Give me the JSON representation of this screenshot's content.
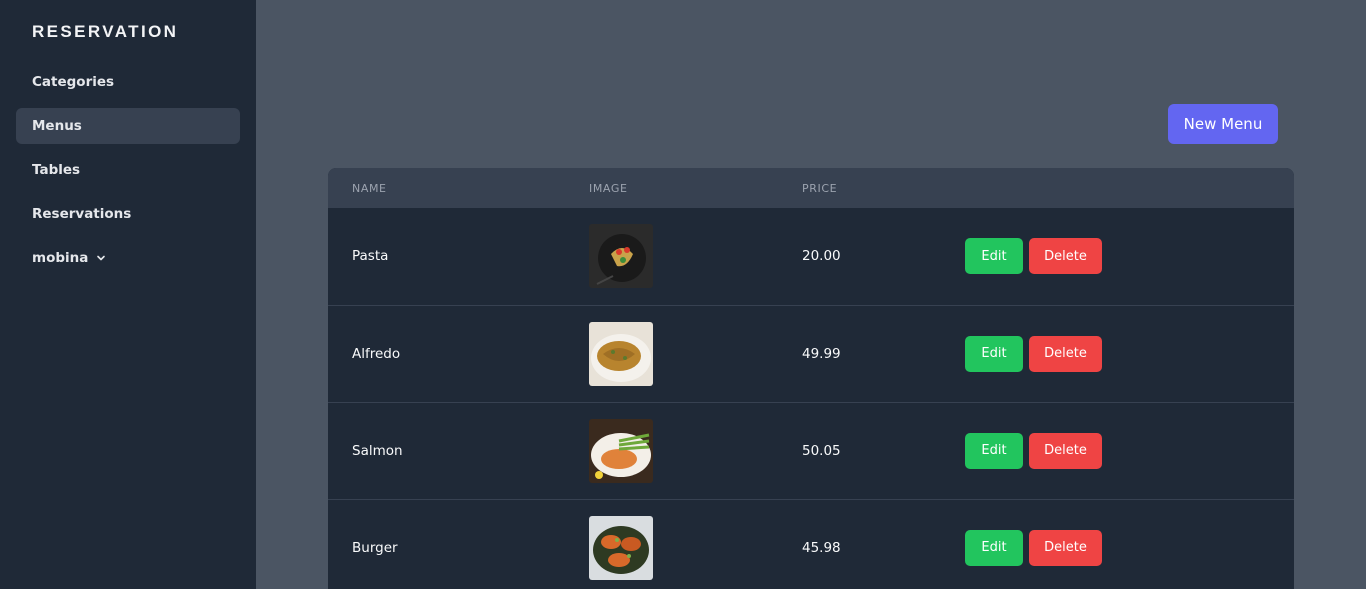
{
  "sidebar": {
    "brand": "RESERVATION",
    "items": [
      {
        "label": "Categories",
        "active": false
      },
      {
        "label": "Menus",
        "active": true
      },
      {
        "label": "Tables",
        "active": false
      },
      {
        "label": "Reservations",
        "active": false
      }
    ],
    "user": {
      "label": "mobina",
      "icon": "chevron-down-icon"
    }
  },
  "toolbar": {
    "new_menu_label": "New Menu"
  },
  "table": {
    "headers": [
      "NAME",
      "IMAGE",
      "PRICE"
    ],
    "rows": [
      {
        "name": "Pasta",
        "image": "pasta-image",
        "price": "20.00",
        "edit": "Edit",
        "delete": "Delete"
      },
      {
        "name": "Alfredo",
        "image": "alfredo-image",
        "price": "49.99",
        "edit": "Edit",
        "delete": "Delete"
      },
      {
        "name": "Salmon",
        "image": "salmon-image",
        "price": "50.05",
        "edit": "Edit",
        "delete": "Delete"
      },
      {
        "name": "Burger",
        "image": "burger-image",
        "price": "45.98",
        "edit": "Edit",
        "delete": "Delete"
      }
    ]
  },
  "colors": {
    "accent": "#6366f1",
    "edit": "#22c55e",
    "delete": "#ef4444",
    "sidebar_bg": "#1f2937",
    "main_bg": "#4b5563"
  }
}
